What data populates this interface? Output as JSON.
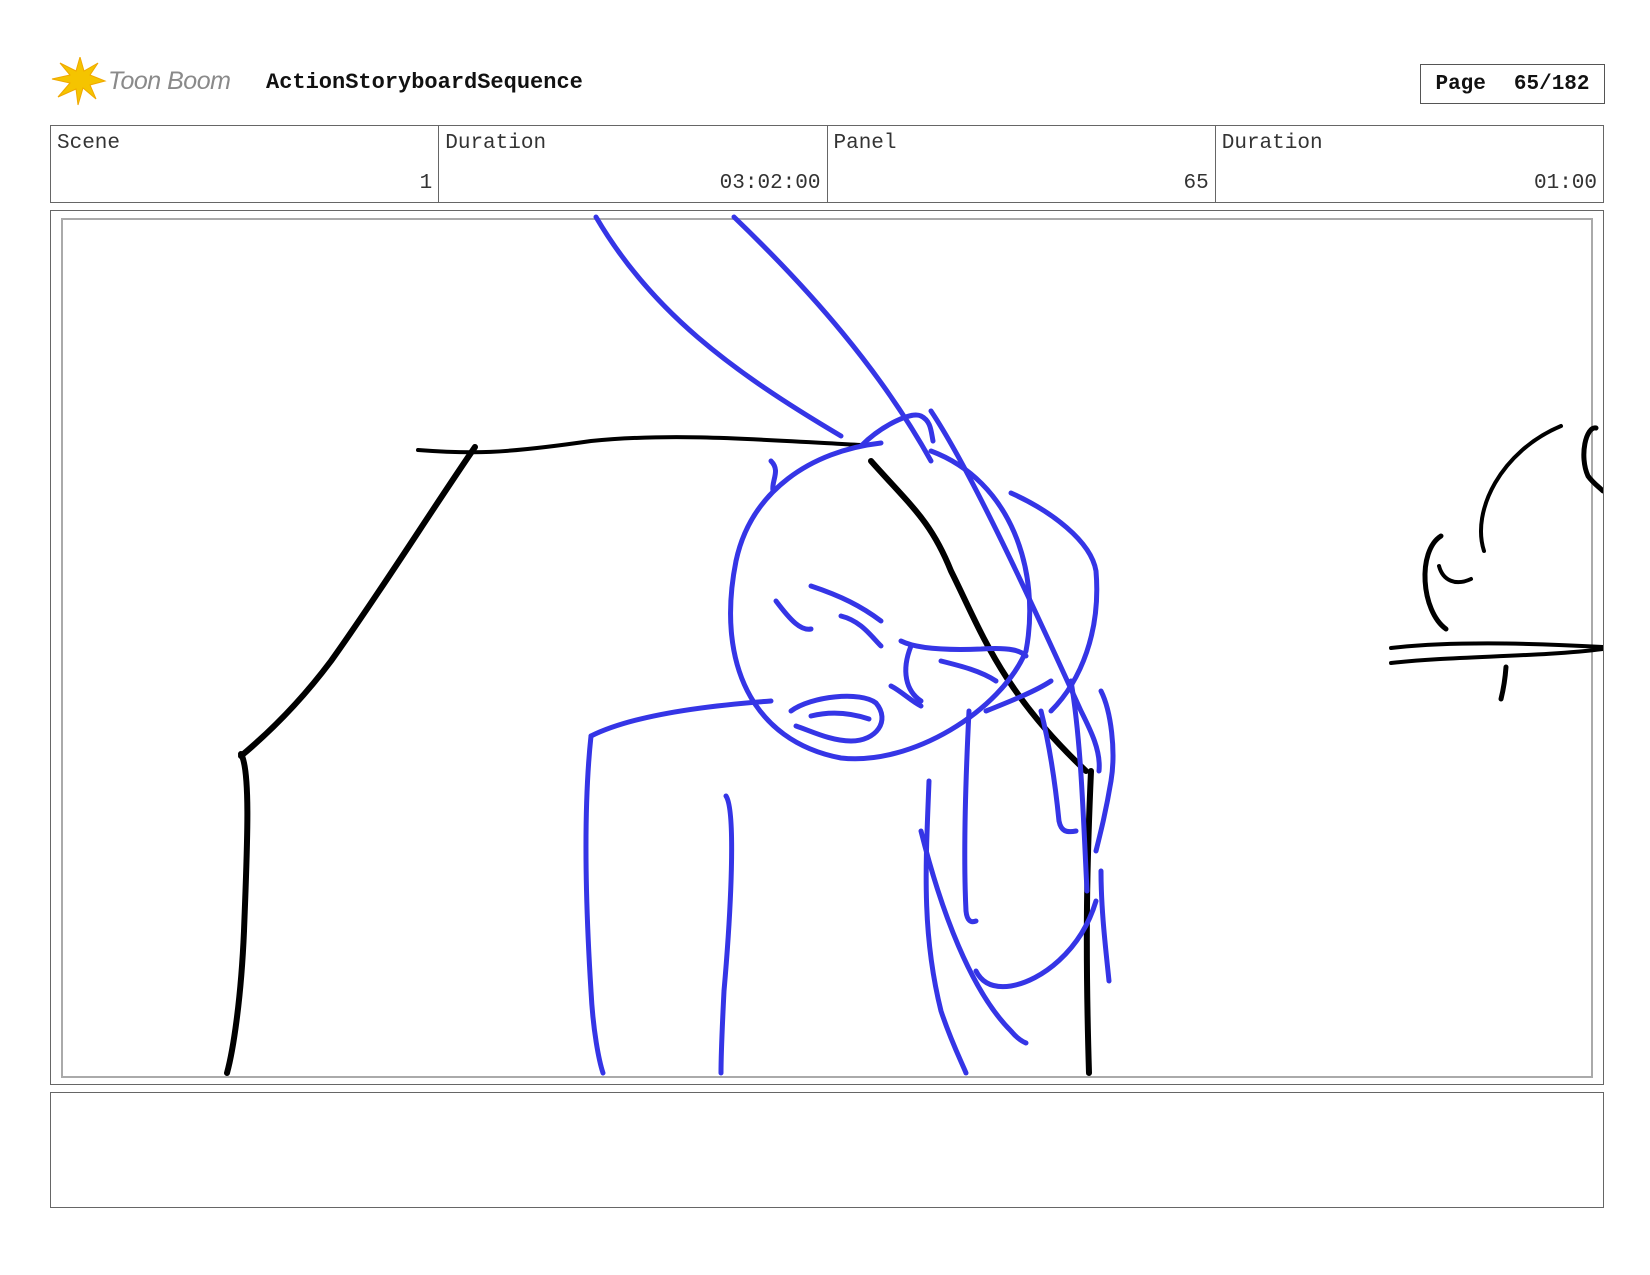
{
  "header": {
    "logo_text": "Toon Boom",
    "sequence_title": "ActionStoryboardSequence",
    "page_label": "Page",
    "page_value": "65/182"
  },
  "info": {
    "scene_label": "Scene",
    "scene_value": "1",
    "scene_duration_label": "Duration",
    "scene_duration_value": "03:02:00",
    "panel_label": "Panel",
    "panel_value": "65",
    "panel_duration_label": "Duration",
    "panel_duration_value": "01:00"
  },
  "colors": {
    "sketch_blue": "#3535e6",
    "sketch_black": "#000000",
    "logo_yellow": "#f5c400"
  },
  "notes": {
    "text": ""
  }
}
